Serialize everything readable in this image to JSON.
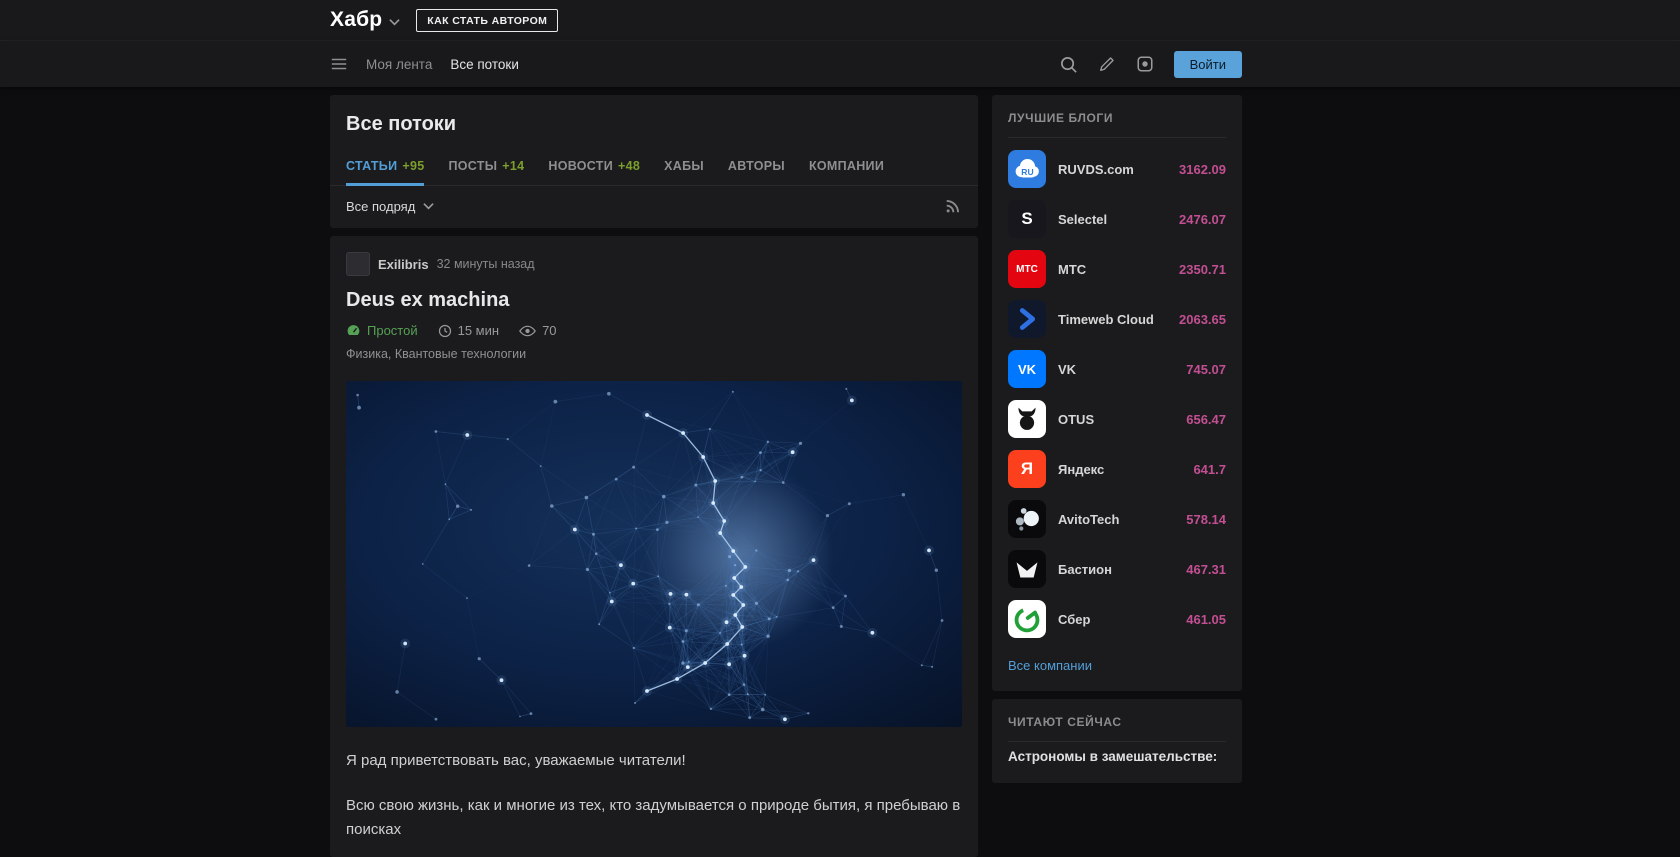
{
  "colors": {
    "page_bg": "#0d0d0f",
    "card_bg": "#1b1b1d",
    "accent": "#529fd8",
    "counter_green": "#7c9f2d",
    "complexity_green": "#55a155",
    "rating_pink": "#c24f92",
    "login_bg": "#5aa3da"
  },
  "icons": {
    "logo_dropdown": "chevron-down",
    "menu": "hamburger",
    "search": "magnifier",
    "write": "pen",
    "services": "rounded-square-with-dot",
    "filter_dropdown": "chevron-down",
    "rss": "rss-waves",
    "complexity": "gauge",
    "reading_time": "clock",
    "views": "eye"
  },
  "topbar": {
    "logo": "Хабр",
    "become_author": "КАК СТАТЬ АВТОРОМ"
  },
  "navbar": {
    "my_feed": "Моя лента",
    "all_streams": "Все потоки",
    "login": "Войти"
  },
  "main": {
    "title": "Все потоки",
    "tabs": [
      {
        "label": "СТАТЬИ",
        "count": "+95",
        "active": true
      },
      {
        "label": "ПОСТЫ",
        "count": "+14",
        "active": false
      },
      {
        "label": "НОВОСТИ",
        "count": "+48",
        "active": false
      },
      {
        "label": "ХАБЫ",
        "active": false
      },
      {
        "label": "АВТОРЫ",
        "active": false
      },
      {
        "label": "КОМПАНИИ",
        "active": false
      }
    ],
    "filter": {
      "label": "Все подряд"
    },
    "article": {
      "author": "Exilibris",
      "time_ago": "32 минуты назад",
      "title": "Deus ex machina",
      "complexity": "Простой",
      "reading_time": "15 мин",
      "views": "70",
      "hubs": "Физика, Квантовые технологии",
      "cover_description": "dark-blue plexus network forming a human face profile",
      "paragraphs": [
        "Я рад приветствовать вас, уважаемые читатели!",
        "Всю свою жизнь, как и многие из тех, кто задумывается о природе бытия, я пребываю в поисках"
      ]
    }
  },
  "sidebar": {
    "best_blogs_title": "ЛУЧШИЕ БЛОГИ",
    "companies": [
      {
        "name": "RUVDS.com",
        "rating": "3162.09",
        "logo_text": "RU",
        "logo_bg": "#2e7ce0"
      },
      {
        "name": "Selectel",
        "rating": "2476.07",
        "logo_text": "S",
        "logo_bg": "#17171d"
      },
      {
        "name": "МТС",
        "rating": "2350.71",
        "logo_text": "МТС",
        "logo_bg": "#e30611"
      },
      {
        "name": "Timeweb Cloud",
        "rating": "2063.65",
        "logo_bg": "#10182b"
      },
      {
        "name": "VK",
        "rating": "745.07",
        "logo_text": "VK",
        "logo_bg": "#0077ff"
      },
      {
        "name": "OTUS",
        "rating": "656.47",
        "logo_bg": "#ffffff"
      },
      {
        "name": "Яндекс",
        "rating": "641.7",
        "logo_text": "Я",
        "logo_bg": "#fc3f1d"
      },
      {
        "name": "AvitoTech",
        "rating": "578.14",
        "logo_bg": "#0a0a0c"
      },
      {
        "name": "Бастион",
        "rating": "467.31",
        "logo_bg": "#0a0a0c"
      },
      {
        "name": "Сбер",
        "rating": "461.05",
        "logo_bg": "#ffffff"
      }
    ],
    "all_companies_link": "Все компании",
    "reading_now_title": "ЧИТАЮТ СЕЙЧАС",
    "reading_now_items": [
      "Астрономы в замешательстве:"
    ]
  }
}
